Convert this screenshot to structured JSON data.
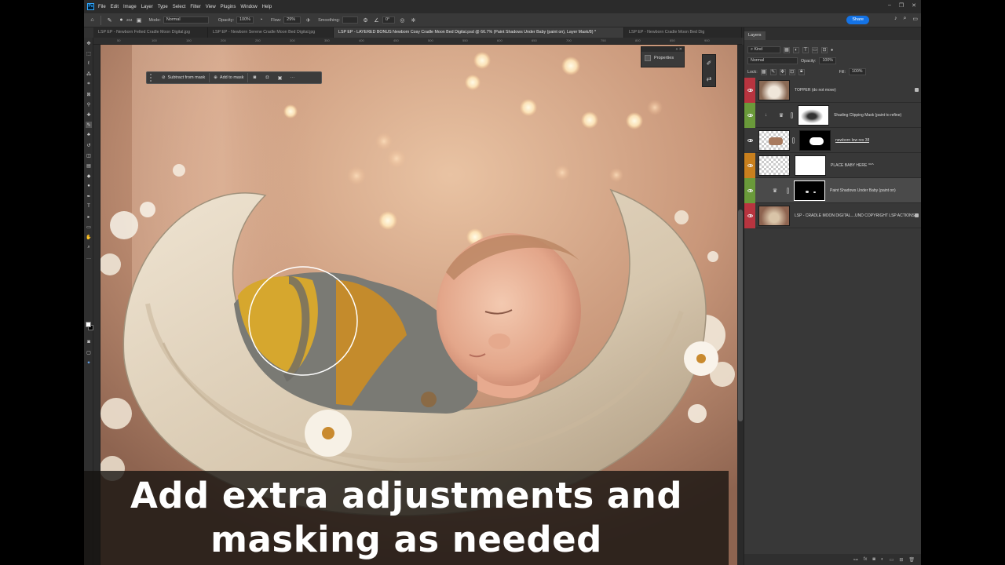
{
  "app": {
    "menu": [
      "File",
      "Edit",
      "Image",
      "Layer",
      "Type",
      "Select",
      "Filter",
      "View",
      "Plugins",
      "Window",
      "Help"
    ],
    "window_controls": [
      "–",
      "❐",
      "✕"
    ]
  },
  "options_bar": {
    "brush_size": "204",
    "mode_label": "Mode:",
    "mode_value": "Normal",
    "opacity_label": "Opacity:",
    "opacity_value": "100%",
    "flow_label": "Flow:",
    "flow_value": "29%",
    "smoothing_label": "Smoothing:",
    "angle_value": "0°",
    "share_label": "Share"
  },
  "tabs": [
    {
      "label": "LSP EP - Newborn Felted Cradle Moon Digital.jpg",
      "active": false
    },
    {
      "label": "LSP EP - Newborn Serene Cradle Moon Bed Digital.jpg",
      "active": false
    },
    {
      "label": "LSP EP - LAYERED BONUS Newborn Cosy Cradle Moon Bed Digital.psd @ 66.7% (Paint Shadows Under Baby (paint on), Layer Mask/8) *",
      "active": true
    },
    {
      "label": "LSP EP - Newborn Cradle Moon Bed Dig",
      "active": false
    }
  ],
  "ruler_ticks": [
    "50",
    "100",
    "150",
    "200",
    "250",
    "300",
    "350",
    "400",
    "450",
    "500",
    "550",
    "600",
    "650",
    "700",
    "750",
    "800",
    "850",
    "900"
  ],
  "task_bar": {
    "subtract_label": "Subtract from mask",
    "add_label": "Add to mask",
    "more": "···"
  },
  "properties": {
    "label": "Properties",
    "top_glyphs": "» ✕"
  },
  "caption": {
    "line1": "Add extra adjustments and",
    "line2": "masking as needed"
  },
  "layers_panel": {
    "tab_label": "Layers",
    "kind_label": "Kind",
    "blend_mode": "Normal",
    "opacity_label": "Opacity:",
    "opacity_value": "100%",
    "lock_label": "Lock:",
    "fill_label": "Fill:",
    "fill_value": "100%",
    "layers": [
      {
        "name": "TOPPER (do not move)",
        "tag_color": "#b8343f",
        "thumb": "photo",
        "locked": true,
        "selected": false
      },
      {
        "name": "Shading Clipping Mask (paint to refine)",
        "tag_color": "#6a9a3a",
        "thumb": "adjustment",
        "mask": "soft-white",
        "locked": false,
        "selected": false
      },
      {
        "name": "newborn low res 38",
        "tag_color": "#383838",
        "thumb": "baby",
        "mask": "baby-silhouette",
        "locked": false,
        "selected": false
      },
      {
        "name": "PLACE BABY HERE ^^^",
        "tag_color": "#c9801e",
        "thumb": "transparent",
        "mask": "white",
        "locked": false,
        "selected": false
      },
      {
        "name": "Paint Shadows Under Baby (paint on)",
        "tag_color": "#6a9a3a",
        "thumb": "adjustment",
        "mask": "black",
        "locked": false,
        "selected": true
      },
      {
        "name": "LSP - CRADLE MOON DIGITAL....UND COPYRIGHT LSP ACTIONS",
        "tag_color": "#b8343f",
        "thumb": "photo",
        "locked": true,
        "selected": false
      }
    ]
  },
  "colors": {
    "accent": "#1473e6",
    "canvas_bg": "#b8866a",
    "panel_bg": "#383838"
  }
}
